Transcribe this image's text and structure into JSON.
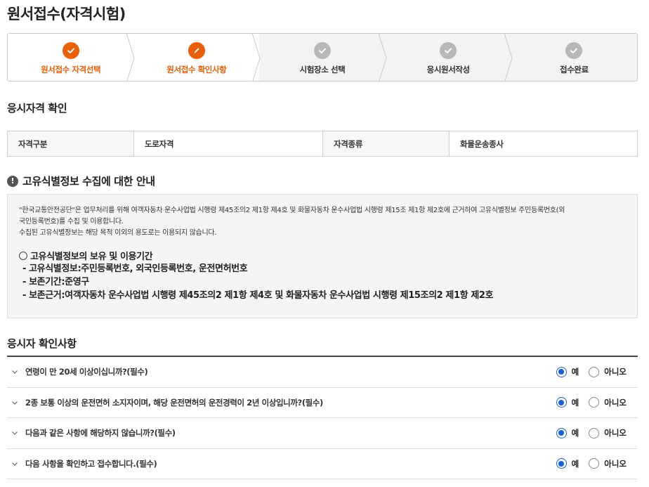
{
  "page": {
    "title": "원서접수(자격시험)"
  },
  "stepper": [
    {
      "label": "원서접수 자격선택",
      "state": "done",
      "icon": "check-icon"
    },
    {
      "label": "원서접수 확인사항",
      "state": "current",
      "icon": "pencil-icon"
    },
    {
      "label": "시험장소 선택",
      "state": "pending",
      "icon": "check-icon"
    },
    {
      "label": "응시원서작성",
      "state": "pending",
      "icon": "check-icon"
    },
    {
      "label": "접수완료",
      "state": "pending",
      "icon": "check-icon"
    }
  ],
  "colors": {
    "accent": "#e8600b",
    "pending": "#b8b8b8",
    "radio": "#1a5fd6"
  },
  "qualification": {
    "title": "응시자격 확인",
    "h1": "자격구분",
    "v1": "도로자격",
    "h2": "자격종류",
    "v2": "화물운송종사"
  },
  "notice": {
    "title": "고유식별정보 수집에 대한 안내",
    "p1": "\"한국교통안전공단\"은 업무처리를 위해 여객자동차 운수사업법 시행령 제45조의2 제1항 제4호 및 화물자동차 운수사업법 시행령 제15조 제1항 제2호에 근거하여 고유식별정보 주민등록번호(외",
    "p2": "국인등록번호)를 수집 및 이용합니다.",
    "p3": "수집된 고유식별정보는 해당 목적 이외의 용도로는 이용되지 않습니다.",
    "sub_title": "고유식별정보의 보유 및 이용기간",
    "b1": "- 고유식별정보:주민등록번호, 외국인등록번호, 운전면허번호",
    "b2": "- 보존기간:준영구",
    "b3": "- 보존근거:여객자동차 운수사업법 시행령 제45조의2 제1항 제4호 및 화물자동차 운수사업법 시행령 제15조의2 제1항 제2호"
  },
  "confirm": {
    "title": "응시자 확인사항",
    "yes": "예",
    "no": "아니오",
    "items": [
      {
        "q": "연령이 만 20세 이상이십니까?(필수)",
        "selected": "yes"
      },
      {
        "q": "2종 보통 이상의 운전면허 소지자이며, 해당 운전면허의 운전경력이 2년 이상입니까?(필수)",
        "selected": "yes"
      },
      {
        "q": "다음과 같은 사항에 해당하지 않습니까?(필수)",
        "selected": "yes"
      },
      {
        "q": "다음 사항을 확인하고 접수합니다.(필수)",
        "selected": "yes"
      }
    ]
  }
}
